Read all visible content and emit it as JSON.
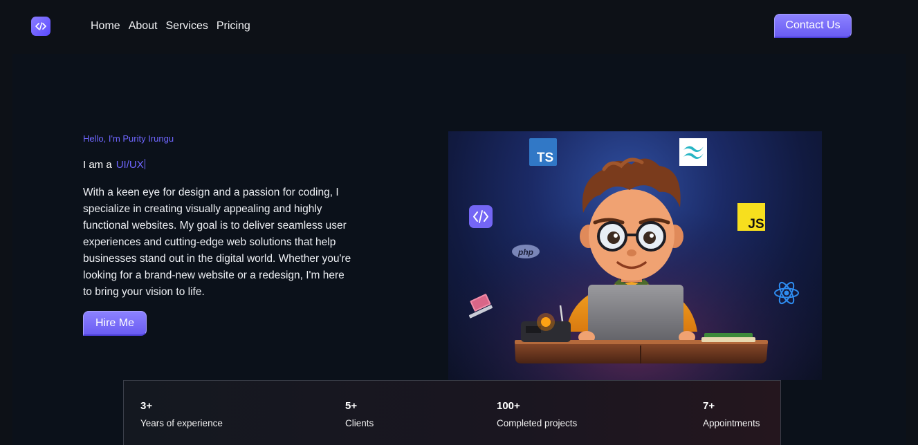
{
  "nav": {
    "logo_icon": "code-icon",
    "links": [
      "Home",
      "About",
      "Services",
      "Pricing"
    ],
    "contact_label": "Contact Us"
  },
  "hero": {
    "greeting": "Hello, I'm Purity Irungu",
    "role_prefix": "I am a",
    "role": "UI/UX",
    "bio": "With a keen eye for design and a passion for coding, I specialize in creating visually appealing and highly functional websites. My goal is to deliver seamless user experiences and cutting-edge web solutions that help businesses stand out in the digital world. Whether you're looking for a brand-new website or a redesign, I'm here to bring your vision to life.",
    "cta_label": "Hire Me"
  },
  "illustration": {
    "badges": {
      "typescript": "TS",
      "javascript": "JS",
      "php": "php"
    },
    "icons": [
      "typescript-icon",
      "tailwind-icon",
      "code-icon",
      "javascript-icon",
      "php-icon",
      "react-icon",
      "laptop-icon"
    ]
  },
  "stats": [
    {
      "value": "3+",
      "label": "Years of experience"
    },
    {
      "value": "5+",
      "label": "Clients"
    },
    {
      "value": "100+",
      "label": "Completed projects"
    },
    {
      "value": "7+",
      "label": "Appointments"
    }
  ],
  "colors": {
    "accent": "#6f66ff",
    "button": "#7b70fb",
    "background": "#0d1117"
  }
}
